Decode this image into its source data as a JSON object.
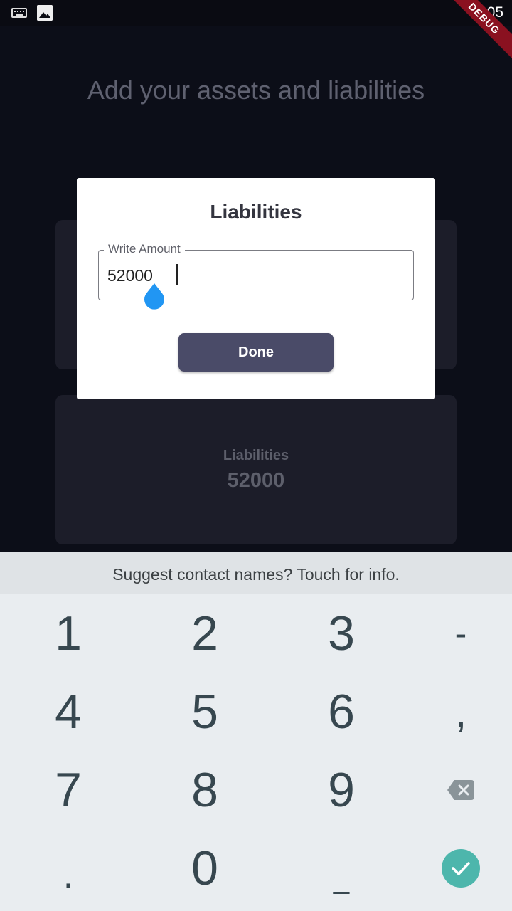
{
  "status_bar": {
    "time": "8:05",
    "debug_banner": "DEBUG",
    "icons": [
      "keyboard-icon",
      "image-icon"
    ]
  },
  "app": {
    "title": "Add your assets and liabilities",
    "liabilities_card": {
      "label": "Liabilities",
      "value": "52000"
    }
  },
  "dialog": {
    "title": "Liabilities",
    "field_label": "Write Amount",
    "field_value": "52000",
    "done_label": "Done"
  },
  "keyboard": {
    "suggestion": "Suggest contact names? Touch for info.",
    "keys": {
      "k1": "1",
      "k2": "2",
      "k3": "3",
      "kminus": "-",
      "k4": "4",
      "k5": "5",
      "k6": "6",
      "kcomma": ",",
      "k7": "7",
      "k8": "8",
      "k9": "9",
      "kperiod": ".",
      "k0": "0",
      "kunderscore": "_"
    }
  },
  "colors": {
    "background": "#0c0e18",
    "card": "#1c1d29",
    "dialog_button": "#4a4b68",
    "cursor_handle": "#2196f3",
    "enter_key": "#4db6ac",
    "debug_ribbon": "#8a1120"
  }
}
